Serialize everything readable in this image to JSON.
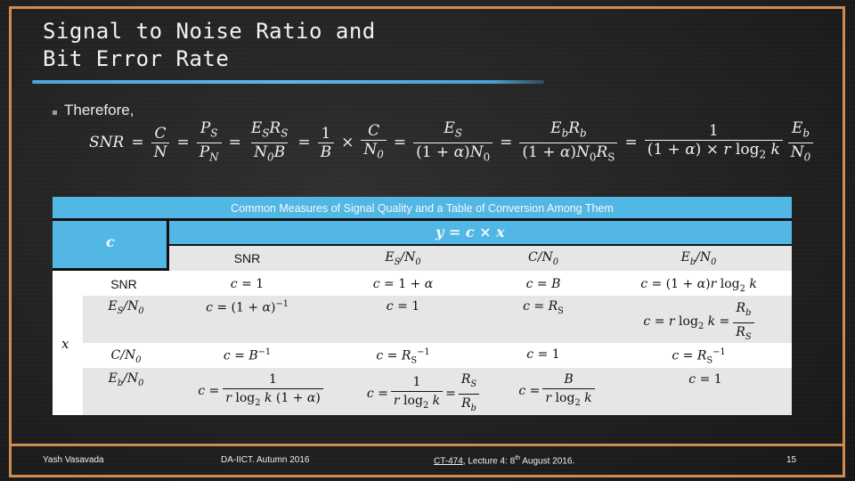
{
  "slide": {
    "title_line1": "Signal to Noise Ratio and",
    "title_line2": "Bit Error Rate",
    "bullet_text": "Therefore,",
    "equation": {
      "lhs": "SNR",
      "terms": [
        {
          "num": "C",
          "den": "N"
        },
        {
          "num": "P_S",
          "den": "P_N"
        },
        {
          "num": "E_S R_S",
          "den": "N_0 B"
        },
        {
          "num": "1",
          "den": "B",
          "times": true,
          "num2": "C",
          "den2": "N_0"
        },
        {
          "num": "E_S",
          "den": "(1 + α)N_0"
        },
        {
          "num": "E_b R_b",
          "den": "(1 + α)N_0 R_S"
        },
        {
          "num": "1",
          "den": "(1 + α) × r log_2 k",
          "num2": "E_b",
          "den2": "N_0"
        }
      ]
    }
  },
  "table": {
    "caption": "Common Measures of Signal Quality and a Table of Conversion Among Them",
    "corner_label": "c",
    "header_formula": "y = c × x",
    "row_axis_label": "x",
    "columns": [
      "SNR",
      "E_S/N_0",
      "C/N_0",
      "E_b/N_0"
    ],
    "rows": [
      {
        "label": "SNR",
        "cells": [
          "c = 1",
          "c = 1 + α",
          "c = B",
          "c = (1 + α) r log₂ k"
        ]
      },
      {
        "label": "E_S/N_0",
        "cells": [
          "c = (1 + α)⁻¹",
          "c = 1",
          "c = R_S",
          "c = r log₂ k = R_b / R_S"
        ]
      },
      {
        "label": "C/N_0",
        "cells": [
          "c = B⁻¹",
          "c = R_S⁻¹",
          "c = 1",
          "c = R_S⁻¹"
        ]
      },
      {
        "label": "E_b/N_0",
        "cells": [
          "c = 1 / (r log₂ k (1 + α))",
          "c = 1 / (r log₂ k) = R_S / R_b",
          "c = B / (r log₂ k)",
          "c = 1"
        ]
      }
    ]
  },
  "footer": {
    "author": "Yash Vasavada",
    "institution": "DA-IICT.  Autumn 2016",
    "course_link": "CT-474",
    "lecture": "Lecture 4:",
    "date_day": "8",
    "date_suffix": "th",
    "date_rest": "August 2016.",
    "page_number": "15"
  },
  "colors": {
    "frame": "#d08c4e",
    "table_header": "#52b7e4",
    "underline": "#5cb8e2"
  }
}
